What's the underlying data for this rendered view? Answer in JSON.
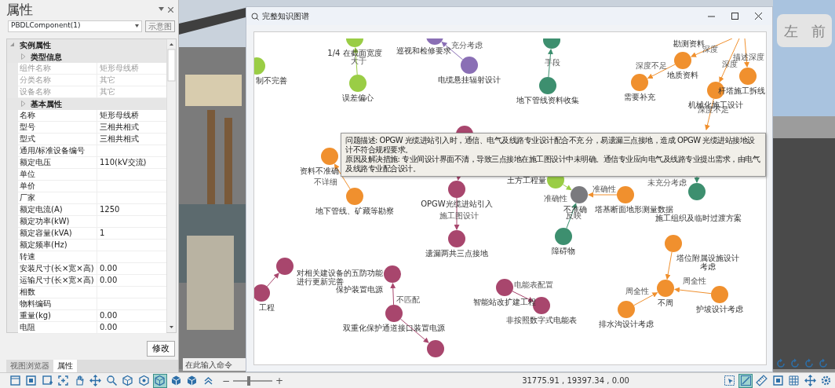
{
  "panel": {
    "title": "属性",
    "component": "PBDLComponent(1)",
    "diagram_button": "示意图",
    "groups": [
      {
        "title": "实例属性",
        "expanded": true,
        "sections": [
          {
            "title": "类型信息",
            "expanded": false,
            "rows": [
              {
                "label": "组件名称",
                "value": "矩形母线桥",
                "disabled": true
              },
              {
                "label": "分类名称",
                "value": "其它",
                "disabled": true
              },
              {
                "label": "设备名称",
                "value": "其它",
                "disabled": true
              }
            ]
          },
          {
            "title": "基本属性",
            "expanded": false,
            "rows": [
              {
                "label": "名称",
                "value": "矩形母线桥",
                "disabled": false
              },
              {
                "label": "型号",
                "value": "三相共相式",
                "disabled": false
              },
              {
                "label": "型式",
                "value": "三相共相式",
                "disabled": false
              },
              {
                "label": "通用/标准设备编号",
                "disabled": false
              },
              {
                "label": "额定电压",
                "value": "110(kV交流)",
                "disabled": false
              },
              {
                "label": "单位",
                "disabled": false
              },
              {
                "label": "单价",
                "disabled": false
              },
              {
                "label": "厂家",
                "disabled": false
              },
              {
                "label": "额定电流(A)",
                "value": "1250",
                "disabled": false
              },
              {
                "label": "额定功率(kW)",
                "disabled": false
              },
              {
                "label": "额定容量(kVA)",
                "value": "1",
                "disabled": false
              },
              {
                "label": "额定频率(Hz)",
                "disabled": false
              },
              {
                "label": "转速",
                "disabled": false
              },
              {
                "label": "安装尺寸(长×宽×高)",
                "value": "0.00",
                "disabled": false
              },
              {
                "label": "运输尺寸(长×宽×高)",
                "value": "0.00",
                "disabled": false
              },
              {
                "label": "相数",
                "disabled": false
              },
              {
                "label": "物料编码",
                "disabled": false
              },
              {
                "label": "重量(kg)",
                "value": "0.00",
                "disabled": false
              },
              {
                "label": "电阻",
                "value": "0.00",
                "disabled": false
              }
            ]
          }
        ]
      }
    ],
    "modify_button": "修改",
    "tabs": [
      {
        "label": "视图浏览器",
        "selected": false
      },
      {
        "label": "属性",
        "selected": true
      }
    ]
  },
  "dialog": {
    "title": "完整知识图谱"
  },
  "graph": {
    "nodes": [
      {
        "label": "制不完善",
        "color": "#9acd45"
      },
      {
        "label": "1/4 在截面宽度",
        "color": "#9acd45"
      },
      {
        "label": "误差偏心",
        "color": "#9acd45"
      },
      {
        "label": "巡视和检修要求",
        "color": "#8a6fb5"
      },
      {
        "label": "电缆悬挂辐射设计",
        "color": "#8a6fb5"
      },
      {
        "color": "#3d8f6f"
      },
      {
        "label": "地下管线资料收集",
        "color": "#3d8f6f"
      },
      {
        "label": "地质资料",
        "color": "#f0902e"
      },
      {
        "label": "需要补充",
        "color": "#f0902e"
      },
      {
        "label": "机械化施工设计",
        "color": "#f0902e"
      },
      {
        "label": "杆塔施工拆线",
        "color": "#f0902e"
      },
      {
        "label": "施工组织及临时过渡方案",
        "color": "#3d8f6f"
      },
      {
        "color": "#a8466d"
      },
      {
        "label": "OPGW光缆进站引入",
        "color": "#a8466d"
      },
      {
        "label": "遗漏两共三点接地",
        "color": "#a8466d"
      },
      {
        "label": "资料不准确",
        "color": "#f0902e"
      },
      {
        "label": "地下管线、矿藏等勘察",
        "color": "#f0902e"
      },
      {
        "label": "土方工程量",
        "color": "#9acd45"
      },
      {
        "label": "不准确",
        "color": "#7a7a7e"
      },
      {
        "label": "塔基断面地形测量数据",
        "color": "#f0902e"
      },
      {
        "label": "障碍物",
        "color": "#3d8f6f"
      },
      {
        "label": "对相关建设备的五防功能",
        "label_2": "进行更新完善",
        "color": "#a8466d"
      },
      {
        "label": "工程",
        "color": "#a8466d"
      },
      {
        "label": "保护装置电源",
        "color": "#a8466d"
      },
      {
        "label": "双重化保护通道接口装置电源",
        "color": "#a8466d"
      },
      {
        "color": "#a8466d"
      },
      {
        "label": "智能站改扩建工程",
        "color": "#a8466d"
      },
      {
        "label": "非按照数字式电能表",
        "color": "#a8466d"
      },
      {
        "label": "塔位附属设施设计",
        "label_2": "考虑",
        "color": "#f0902e"
      },
      {
        "label": "不周",
        "color": "#f0902e"
      },
      {
        "label": "排水沟设计考虑",
        "color": "#f0902e"
      },
      {
        "label": "护坡设计考虑",
        "color": "#f0902e"
      }
    ],
    "edge_labels": [
      "大于",
      "充分考虑",
      "手段",
      "深度不足",
      "深度",
      "深度",
      "描述深度",
      "深度不足",
      "未充分考虑",
      "施工图设计",
      "不详细",
      "准确性",
      "准确性",
      "反映",
      "不匹配",
      "电能表配置",
      "周全性",
      "周全性"
    ],
    "outside_labels": [
      "勘测资料"
    ]
  },
  "tooltip": {
    "lines": [
      "问题描述: OPGW 光缆进站引入时，通信、电气及线路专业设计配合不充 分，易遗漏三点接地，造成 OPGW 光缆进站接地设计不符合规程要求。",
      "原因及解决措施: 专业间设计界面不清，导致三点接地在施工图设计中未明确。通信专业应向电气及线路专业提出需求，由电气及线路专业配合设计。"
    ]
  },
  "view_cube": {
    "faces": [
      "左",
      "前"
    ]
  },
  "command": {
    "placeholder": "在此输入命令"
  },
  "status_bar": {
    "tools": [
      {
        "kind": "page",
        "selected": false
      },
      {
        "kind": "frame",
        "selected": false
      },
      {
        "kind": "window",
        "selected": false
      },
      {
        "kind": "crosshair",
        "selected": false
      },
      {
        "kind": "hand",
        "selected": false
      },
      {
        "kind": "move",
        "selected": false
      },
      {
        "kind": "zoom",
        "selected": false
      },
      {
        "kind": "cube",
        "selected": false
      },
      {
        "kind": "cube-dot",
        "selected": false
      },
      {
        "kind": "cube",
        "selected": true
      },
      {
        "kind": "cube-solid",
        "selected": false
      },
      {
        "kind": "cube-solid",
        "selected": false
      },
      {
        "kind": "chevrons",
        "selected": false
      }
    ],
    "zoom": {
      "minus": "−",
      "plus": "+",
      "level": 0.4
    },
    "coordinates": "31775.91 , 19397.34 , 0.00",
    "right_tools": [
      {
        "kind": "select",
        "selected": false
      },
      {
        "kind": "slash",
        "selected": true
      },
      {
        "kind": "ruler",
        "selected": false
      },
      {
        "kind": "frame",
        "selected": false
      },
      {
        "kind": "grid",
        "selected": false
      },
      {
        "kind": "move",
        "selected": false
      },
      {
        "kind": "gear",
        "selected": false
      }
    ]
  }
}
